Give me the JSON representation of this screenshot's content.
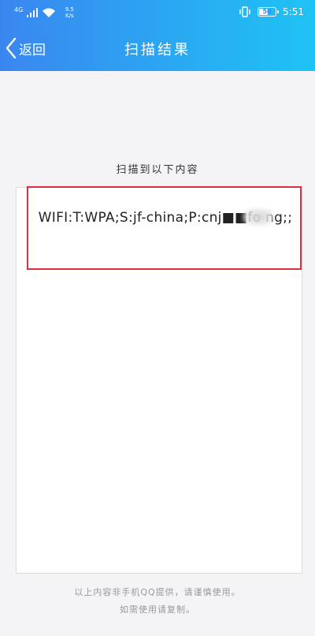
{
  "status_bar": {
    "network": "4G",
    "speed_value": "9.5",
    "speed_unit": "K/s",
    "battery": "50",
    "time": "5:51"
  },
  "nav": {
    "back_label": "返回",
    "title": "扫描结果"
  },
  "intro": "扫描到以下内容",
  "result": {
    "text": "WIFI:T:WPA;S:jf-china;P:cnj■■fo ng;;"
  },
  "footer": {
    "line1": "以上内容非手机QQ提供，请谨慎使用。",
    "line2": "如需使用请复制。"
  },
  "colors": {
    "header_start": "#3a86f0",
    "header_end": "#1ec3f5",
    "highlight_border": "#e02e3c",
    "background": "#f4f4f6"
  }
}
